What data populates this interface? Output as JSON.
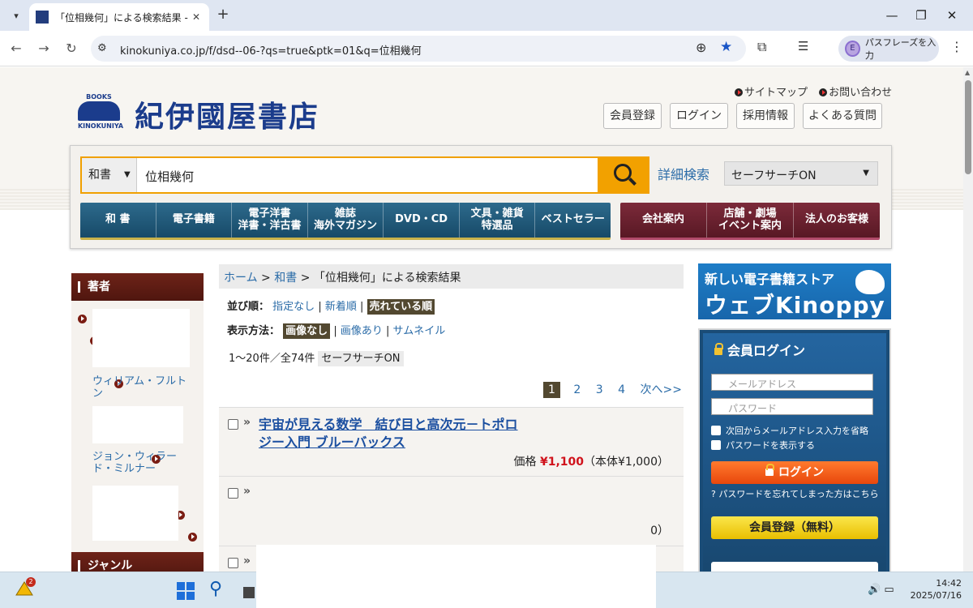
{
  "browser": {
    "tab_title": "「位相幾何」による検索結果 - 紀伊",
    "url": "kinokuniya.co.jp/f/dsd--06-?qs=true&ptk=01&q=位相幾何",
    "profile_initial": "E",
    "passphrase_label": "パスフレーズを入力"
  },
  "header": {
    "logo_books": "BOOKS",
    "logo_sub": "KINOKUNIYA",
    "store_name": "紀伊國屋書店",
    "top_links": [
      "サイトマップ",
      "お問い合わせ"
    ],
    "buttons": [
      "会員登録",
      "ログイン",
      "採用情報",
      "よくある質問"
    ]
  },
  "search": {
    "category": "和書",
    "query": "位相幾何",
    "advanced_label": "詳細検索",
    "safesearch": "セーフサーチON"
  },
  "nav_main": [
    "和 書",
    "電子書籍",
    "電子洋書\n洋書・洋古書",
    "雑誌\n海外マガジン",
    "DVD・CD",
    "文具・雑貨\n特選品",
    "ベストセラー"
  ],
  "nav_corp": [
    "会社案内",
    "店舗・劇場\nイベント案内",
    "法人のお客様"
  ],
  "sidebar": {
    "author_header": "著者",
    "genre_header": "ジャンル",
    "authors": [
      "ウィリアム・フルトン",
      "ジョン・ウィラード・ミルナー"
    ]
  },
  "breadcrumb": {
    "home": "ホーム",
    "sep": ">",
    "cat": "和書",
    "current": "「位相幾何」による検索結果"
  },
  "sort": {
    "label": "並び順：",
    "options": [
      "指定なし",
      "新着順",
      "売れている順"
    ],
    "sep": "|"
  },
  "display": {
    "label": "表示方法：",
    "options": [
      "画像なし",
      "画像あり",
      "サムネイル"
    ]
  },
  "results": {
    "count_text": "1～20件／全74件",
    "safesearch_badge": "セーフサーチON",
    "pages": [
      "1",
      "2",
      "3",
      "4"
    ],
    "next": "次へ>>",
    "items": [
      {
        "title": "宇宙が見える数学　結び目と高次元－トポロジー入門 ブルーバックス",
        "price_label": "価格",
        "price": "¥1,100",
        "price_note": "（本体¥1,000）"
      },
      {
        "price_note_tail": "0）"
      }
    ]
  },
  "right": {
    "banner_line1": "新しい電子書籍ストア",
    "banner_line2": "ウェブKinoppy",
    "login_title": "会員ログイン",
    "email_placeholder": "メールアドレス",
    "password_placeholder": "パスワード",
    "remember": "次回からメールアドレス入力を省略",
    "show_password": "パスワードを表示する",
    "login_button": "ログイン",
    "forgot": "パスワードを忘れてしまった方はこちら",
    "register_button": "会員登録（無料）"
  },
  "taskbar": {
    "badge": "2",
    "time": "14:42",
    "date": "2025/07/16"
  }
}
